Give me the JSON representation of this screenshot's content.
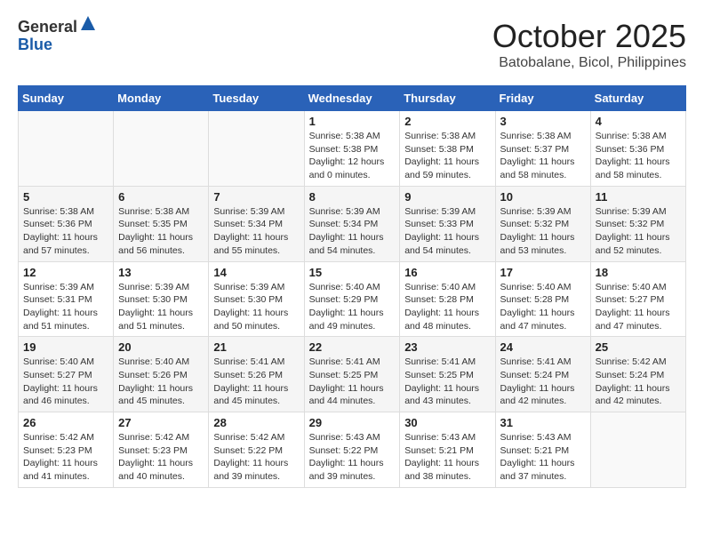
{
  "header": {
    "logo_line1": "General",
    "logo_line2": "Blue",
    "month": "October 2025",
    "location": "Batobalane, Bicol, Philippines"
  },
  "weekdays": [
    "Sunday",
    "Monday",
    "Tuesday",
    "Wednesday",
    "Thursday",
    "Friday",
    "Saturday"
  ],
  "weeks": [
    [
      {
        "day": "",
        "info": ""
      },
      {
        "day": "",
        "info": ""
      },
      {
        "day": "",
        "info": ""
      },
      {
        "day": "1",
        "info": "Sunrise: 5:38 AM\nSunset: 5:38 PM\nDaylight: 12 hours\nand 0 minutes."
      },
      {
        "day": "2",
        "info": "Sunrise: 5:38 AM\nSunset: 5:38 PM\nDaylight: 11 hours\nand 59 minutes."
      },
      {
        "day": "3",
        "info": "Sunrise: 5:38 AM\nSunset: 5:37 PM\nDaylight: 11 hours\nand 58 minutes."
      },
      {
        "day": "4",
        "info": "Sunrise: 5:38 AM\nSunset: 5:36 PM\nDaylight: 11 hours\nand 58 minutes."
      }
    ],
    [
      {
        "day": "5",
        "info": "Sunrise: 5:38 AM\nSunset: 5:36 PM\nDaylight: 11 hours\nand 57 minutes."
      },
      {
        "day": "6",
        "info": "Sunrise: 5:38 AM\nSunset: 5:35 PM\nDaylight: 11 hours\nand 56 minutes."
      },
      {
        "day": "7",
        "info": "Sunrise: 5:39 AM\nSunset: 5:34 PM\nDaylight: 11 hours\nand 55 minutes."
      },
      {
        "day": "8",
        "info": "Sunrise: 5:39 AM\nSunset: 5:34 PM\nDaylight: 11 hours\nand 54 minutes."
      },
      {
        "day": "9",
        "info": "Sunrise: 5:39 AM\nSunset: 5:33 PM\nDaylight: 11 hours\nand 54 minutes."
      },
      {
        "day": "10",
        "info": "Sunrise: 5:39 AM\nSunset: 5:32 PM\nDaylight: 11 hours\nand 53 minutes."
      },
      {
        "day": "11",
        "info": "Sunrise: 5:39 AM\nSunset: 5:32 PM\nDaylight: 11 hours\nand 52 minutes."
      }
    ],
    [
      {
        "day": "12",
        "info": "Sunrise: 5:39 AM\nSunset: 5:31 PM\nDaylight: 11 hours\nand 51 minutes."
      },
      {
        "day": "13",
        "info": "Sunrise: 5:39 AM\nSunset: 5:30 PM\nDaylight: 11 hours\nand 51 minutes."
      },
      {
        "day": "14",
        "info": "Sunrise: 5:39 AM\nSunset: 5:30 PM\nDaylight: 11 hours\nand 50 minutes."
      },
      {
        "day": "15",
        "info": "Sunrise: 5:40 AM\nSunset: 5:29 PM\nDaylight: 11 hours\nand 49 minutes."
      },
      {
        "day": "16",
        "info": "Sunrise: 5:40 AM\nSunset: 5:28 PM\nDaylight: 11 hours\nand 48 minutes."
      },
      {
        "day": "17",
        "info": "Sunrise: 5:40 AM\nSunset: 5:28 PM\nDaylight: 11 hours\nand 47 minutes."
      },
      {
        "day": "18",
        "info": "Sunrise: 5:40 AM\nSunset: 5:27 PM\nDaylight: 11 hours\nand 47 minutes."
      }
    ],
    [
      {
        "day": "19",
        "info": "Sunrise: 5:40 AM\nSunset: 5:27 PM\nDaylight: 11 hours\nand 46 minutes."
      },
      {
        "day": "20",
        "info": "Sunrise: 5:40 AM\nSunset: 5:26 PM\nDaylight: 11 hours\nand 45 minutes."
      },
      {
        "day": "21",
        "info": "Sunrise: 5:41 AM\nSunset: 5:26 PM\nDaylight: 11 hours\nand 45 minutes."
      },
      {
        "day": "22",
        "info": "Sunrise: 5:41 AM\nSunset: 5:25 PM\nDaylight: 11 hours\nand 44 minutes."
      },
      {
        "day": "23",
        "info": "Sunrise: 5:41 AM\nSunset: 5:25 PM\nDaylight: 11 hours\nand 43 minutes."
      },
      {
        "day": "24",
        "info": "Sunrise: 5:41 AM\nSunset: 5:24 PM\nDaylight: 11 hours\nand 42 minutes."
      },
      {
        "day": "25",
        "info": "Sunrise: 5:42 AM\nSunset: 5:24 PM\nDaylight: 11 hours\nand 42 minutes."
      }
    ],
    [
      {
        "day": "26",
        "info": "Sunrise: 5:42 AM\nSunset: 5:23 PM\nDaylight: 11 hours\nand 41 minutes."
      },
      {
        "day": "27",
        "info": "Sunrise: 5:42 AM\nSunset: 5:23 PM\nDaylight: 11 hours\nand 40 minutes."
      },
      {
        "day": "28",
        "info": "Sunrise: 5:42 AM\nSunset: 5:22 PM\nDaylight: 11 hours\nand 39 minutes."
      },
      {
        "day": "29",
        "info": "Sunrise: 5:43 AM\nSunset: 5:22 PM\nDaylight: 11 hours\nand 39 minutes."
      },
      {
        "day": "30",
        "info": "Sunrise: 5:43 AM\nSunset: 5:21 PM\nDaylight: 11 hours\nand 38 minutes."
      },
      {
        "day": "31",
        "info": "Sunrise: 5:43 AM\nSunset: 5:21 PM\nDaylight: 11 hours\nand 37 minutes."
      },
      {
        "day": "",
        "info": ""
      }
    ]
  ]
}
